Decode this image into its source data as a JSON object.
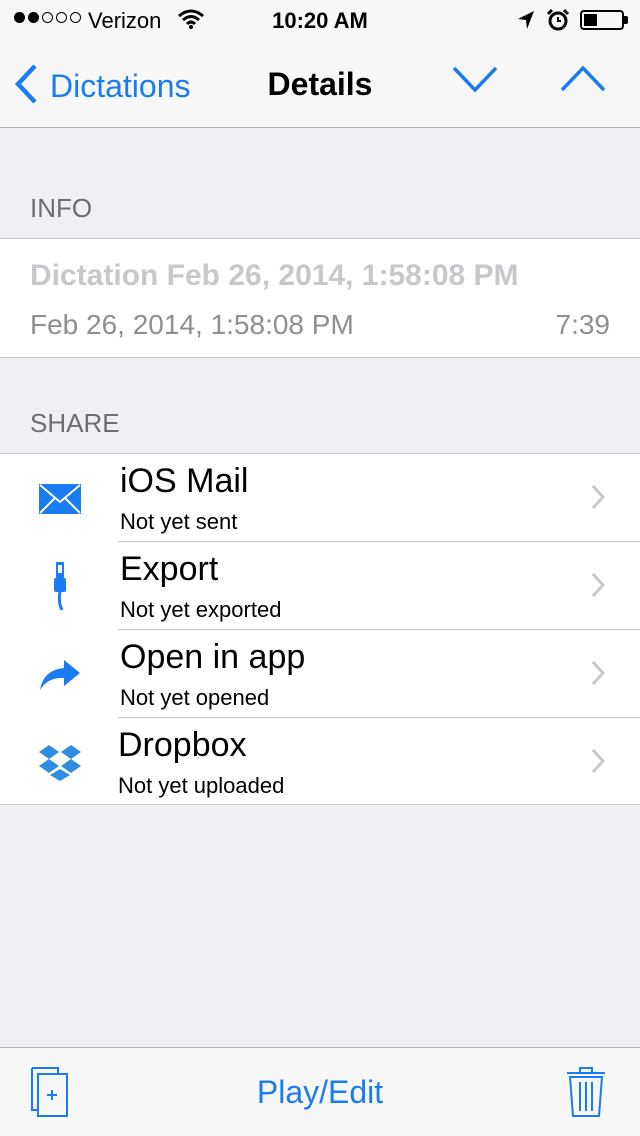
{
  "status_bar": {
    "carrier": "Verizon",
    "time": "10:20 AM",
    "signal_bars_filled": 2,
    "signal_bars_total": 5,
    "battery_level": 0.25,
    "icons": [
      "wifi-icon",
      "location-icon",
      "alarm-icon",
      "battery-icon"
    ]
  },
  "nav": {
    "back_label": "Dictations",
    "title": "Details",
    "icons": [
      "chevron-left-icon",
      "chevron-down-icon",
      "chevron-up-icon"
    ]
  },
  "info": {
    "header": "INFO",
    "title": "Dictation Feb 26, 2014, 1:58:08 PM",
    "date": "Feb 26, 2014, 1:58:08 PM",
    "duration": "7:39"
  },
  "share": {
    "header": "SHARE",
    "items": [
      {
        "label": "iOS Mail",
        "status": "Not yet sent",
        "icon": "mail-icon"
      },
      {
        "label": "Export",
        "status": "Not yet exported",
        "icon": "lightning-cable-icon"
      },
      {
        "label": "Open in app",
        "status": "Not yet opened",
        "icon": "share-arrow-icon"
      },
      {
        "label": "Dropbox",
        "status": "Not yet uploaded",
        "icon": "dropbox-icon"
      }
    ]
  },
  "toolbar": {
    "play_label": "Play/Edit",
    "icons": [
      "new-document-icon",
      "trash-icon"
    ]
  },
  "colors": {
    "accent": "#1a7cf2",
    "background": "#efeff4",
    "bar": "#f7f7f7",
    "secondary_text": "#8e8e93",
    "placeholder_text": "#c7c7cc"
  }
}
